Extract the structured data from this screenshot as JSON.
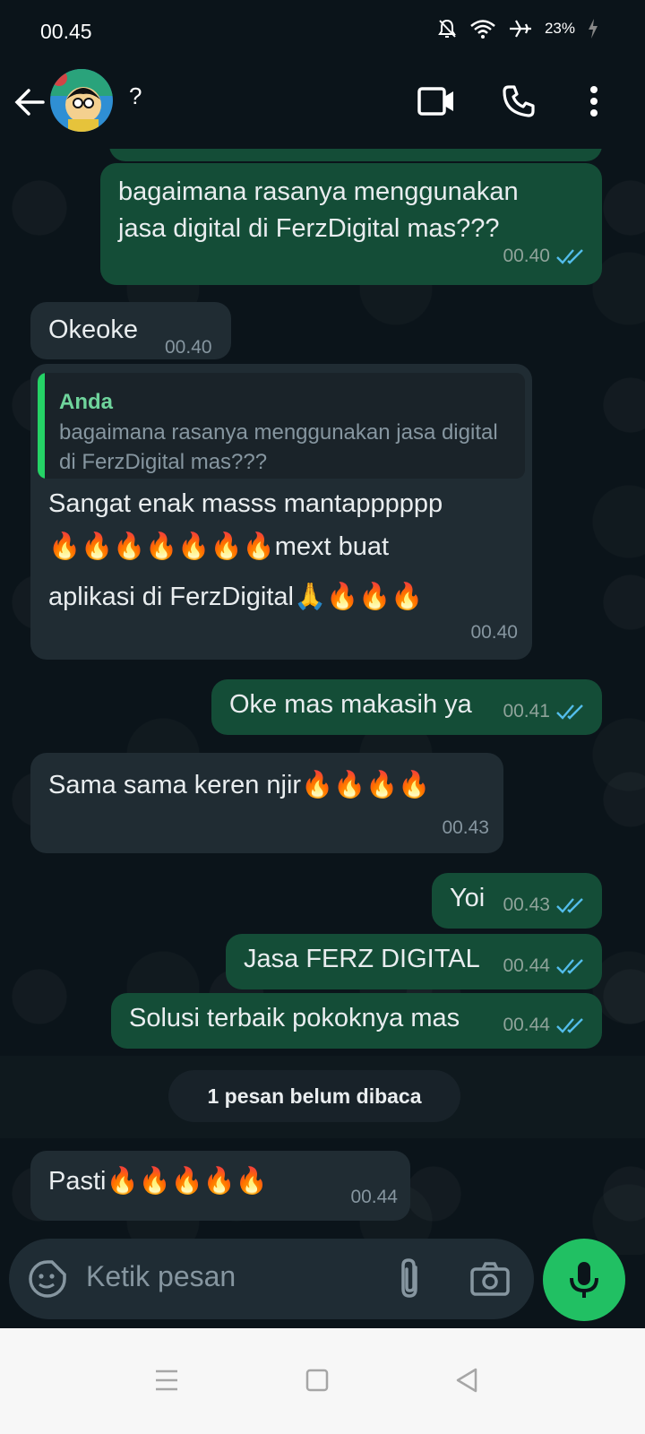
{
  "status_bar": {
    "time": "00.45",
    "battery": "23%"
  },
  "header": {
    "contact_name": "?"
  },
  "messages": [
    {
      "text": "bagaimana rasanya menggunakan jasa digital di FerzDigital mas???",
      "time": "00.40"
    },
    {
      "text": "Okeoke",
      "time": "00.40"
    },
    {
      "quote_author": "Anda",
      "quote_text": "bagaimana rasanya menggunakan jasa digital di FerzDigital mas???",
      "text_line1": "Sangat enak masss mantapppppp",
      "text_line2": "🔥🔥🔥🔥🔥🔥🔥mext buat",
      "text_line3": "aplikasi di FerzDigital🙏🔥🔥🔥",
      "time": "00.40"
    },
    {
      "text": "Oke mas makasih ya",
      "time": "00.41"
    },
    {
      "text": "Sama sama keren njir🔥🔥🔥🔥",
      "time": "00.43"
    },
    {
      "text": "Yoi",
      "time": "00.43"
    },
    {
      "text": "Jasa FERZ DIGITAL",
      "time": "00.44"
    },
    {
      "text": "Solusi terbaik pokoknya mas",
      "time": "00.44"
    },
    {
      "text": "Pasti🔥🔥🔥🔥🔥",
      "time": "00.44"
    }
  ],
  "unread_label": "1 pesan belum dibaca",
  "input": {
    "placeholder": "Ketik pesan"
  },
  "colors": {
    "outgoing_bubble": "#144d37",
    "incoming_bubble": "#202c33",
    "accent": "#21c063",
    "read_ticks": "#53bdeb"
  }
}
